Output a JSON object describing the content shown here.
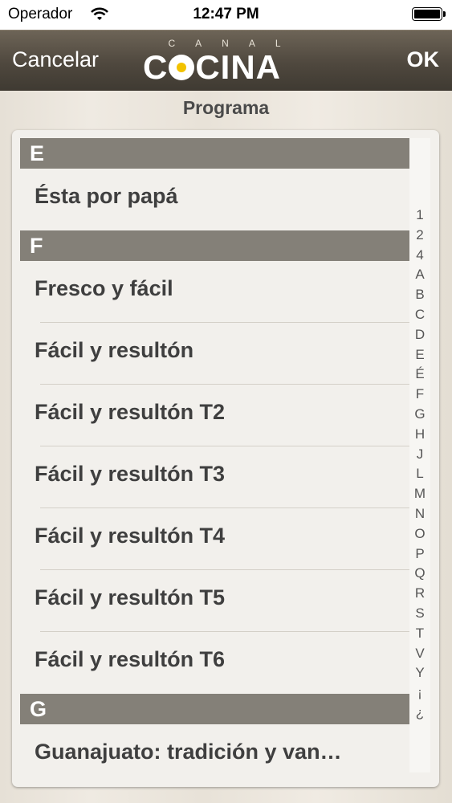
{
  "status_bar": {
    "carrier": "Operador",
    "time": "12:47 PM",
    "battery_level": 1.0
  },
  "nav": {
    "cancel_label": "Cancelar",
    "ok_label": "OK",
    "logo_top": "CANAL",
    "logo_before_o": "C",
    "logo_after_o": "CINA"
  },
  "subtitle": "Programa",
  "sections": [
    {
      "header": "E",
      "items": [
        "Ésta por papá"
      ]
    },
    {
      "header": "F",
      "items": [
        "Fresco y fácil",
        "Fácil y resultón",
        "Fácil y resultón T2",
        "Fácil y resultón T3",
        "Fácil y resultón T4",
        "Fácil y resultón T5",
        "Fácil y resultón T6"
      ]
    },
    {
      "header": "G",
      "items": [
        "Guanajuato: tradición y van…"
      ]
    }
  ],
  "index": [
    "1",
    "2",
    "4",
    "A",
    "B",
    "C",
    "D",
    "E",
    "É",
    "F",
    "G",
    "H",
    "J",
    "L",
    "M",
    "N",
    "O",
    "P",
    "Q",
    "R",
    "S",
    "T",
    "V",
    "Y",
    "¡",
    "¿"
  ]
}
